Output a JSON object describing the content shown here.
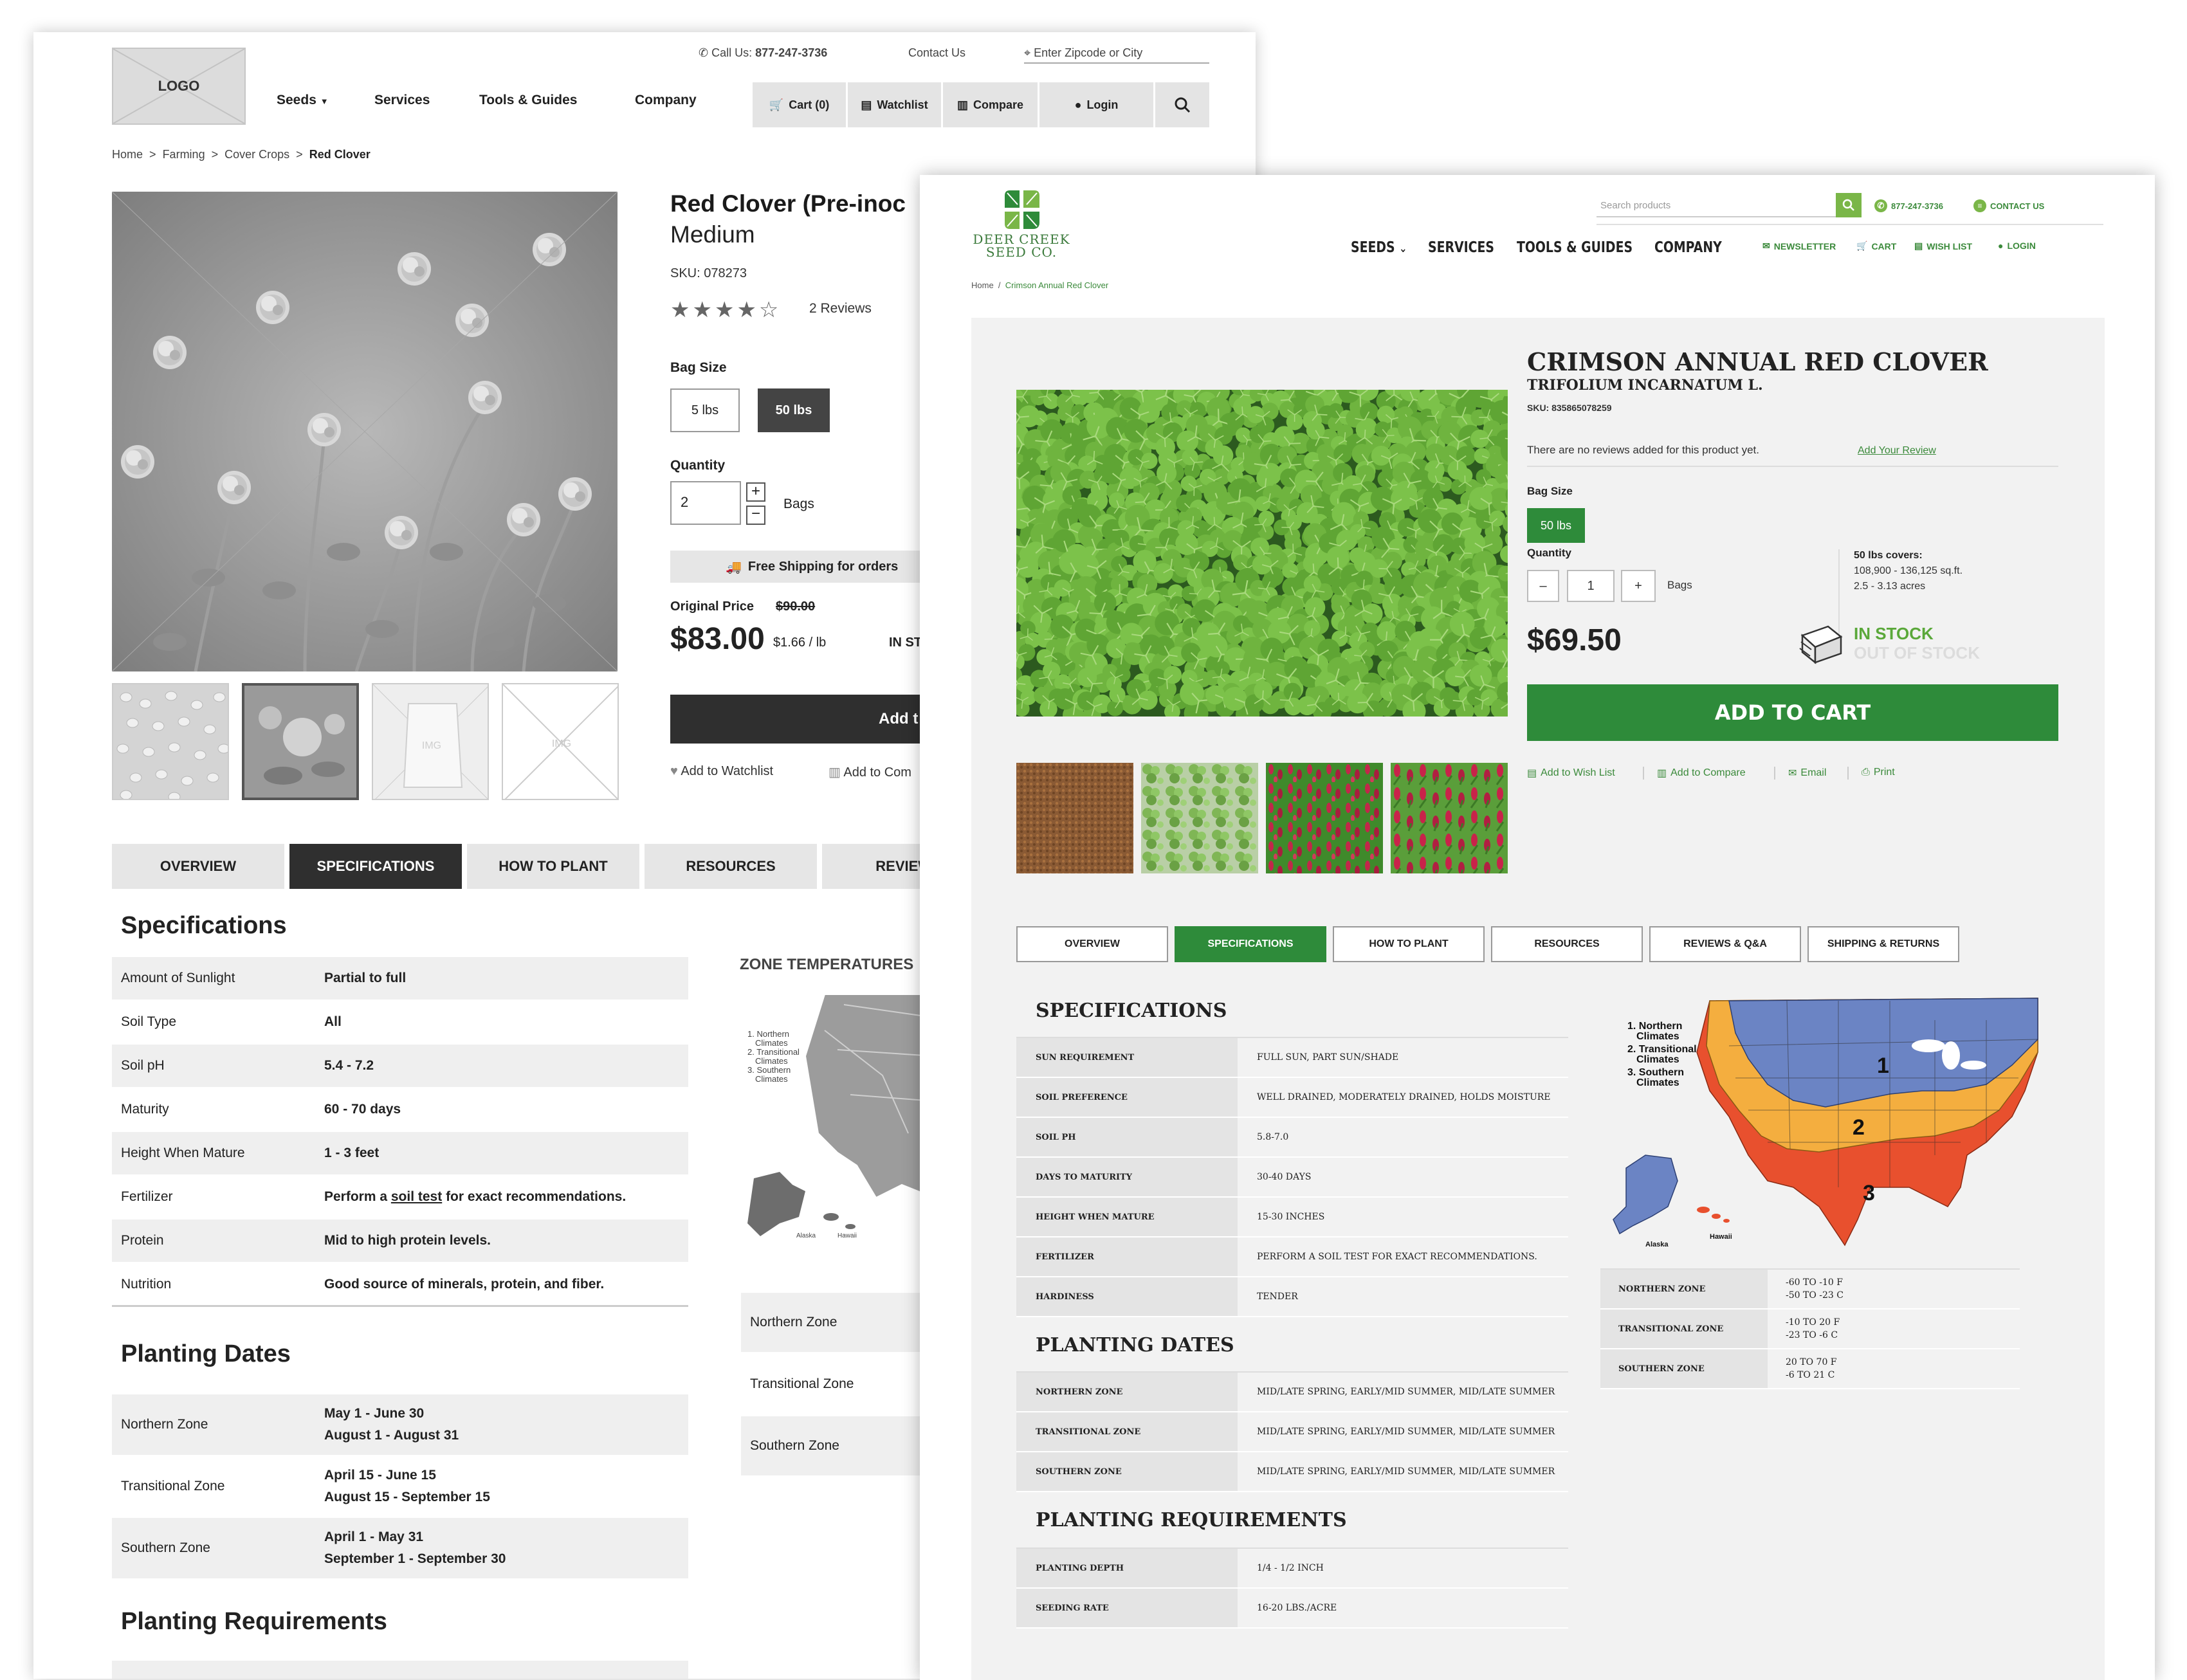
{
  "wireframe": {
    "logo": "LOGO",
    "top_bar": {
      "call_prefix": "Call Us:",
      "phone": "877-247-3736",
      "contact": "Contact Us",
      "zip_placeholder": "Enter Zipcode or City"
    },
    "nav": [
      "Seeds",
      "Services",
      "Tools & Guides",
      "Company"
    ],
    "toolbar": {
      "cart": "Cart (0)",
      "watchlist": "Watchlist",
      "compare": "Compare",
      "login": "Login"
    },
    "breadcrumb": [
      "Home",
      ">",
      "Farming",
      ">",
      "Cover Crops",
      ">",
      "Red Clover"
    ],
    "product": {
      "title": "Red Clover  (Pre-inoc",
      "subtitle": "Medium",
      "sku": "SKU: 078273",
      "stars": "★★★★☆",
      "reviews": "2 Reviews",
      "bag_size_label": "Bag Size",
      "bag_sizes": [
        "5 lbs",
        "50 lbs"
      ],
      "quantity_label": "Quantity",
      "quantity": "2",
      "unit": "Bags",
      "shipping": "Free Shipping for orders",
      "original_price_label": "Original Price",
      "original_price": "$90.00",
      "price": "$83.00",
      "per_lb": "$1.66 / lb",
      "stock": "IN ST",
      "add_button": "Add t",
      "watchlist": "Add to Watchlist",
      "compare": "Add to Com"
    },
    "thumb_img_label": "IMG",
    "tabs": [
      "OVERVIEW",
      "SPECIFICATIONS",
      "HOW TO PLANT",
      "RESOURCES",
      "REVIEWS"
    ],
    "specs_title": "Specifications",
    "specs": [
      {
        "k": "Amount of Sunlight",
        "v": "Partial to full"
      },
      {
        "k": "Soil Type",
        "v": "All"
      },
      {
        "k": "Soil pH",
        "v": "5.4 - 7.2"
      },
      {
        "k": "Maturity",
        "v": " 60 - 70 days"
      },
      {
        "k": "Height When Mature",
        "v": "1 - 3 feet"
      },
      {
        "k": "Protein",
        "v": "Mid to high protein levels."
      },
      {
        "k": "Nutrition",
        "v": "Good source of minerals, protein, and fiber."
      }
    ],
    "fertilizer": {
      "k": "Fertilizer",
      "pre": "Perform a ",
      "link": "soil test",
      "post": " for exact recommendations."
    },
    "planting_title": "Planting Dates",
    "planting": [
      {
        "k": "Northern Zone",
        "v1": "May 1 - June 30",
        "v2": "August 1 - August 31"
      },
      {
        "k": "Transitional Zone",
        "v1": "April 15 - June 15",
        "v2": "August 15 - September 15"
      },
      {
        "k": "Southern Zone",
        "v1": "April 1 - May 31",
        "v2": "September 1 - September 30"
      }
    ],
    "requirements_title": "Planting Requirements",
    "zone_title": "ZONE TEMPERATURES",
    "zone_legend": [
      "1. Northern",
      "Climates",
      "2. Transitional",
      "Climates",
      "3. Southern",
      "Climates"
    ],
    "zone_map_labels": [
      "Alaska",
      "Hawaii"
    ],
    "zone_rows": [
      "Northern Zone",
      "Transitional Zone",
      "Southern Zone"
    ]
  },
  "real": {
    "brand": {
      "line1": "DEER CREEK",
      "line2": "SEED CO."
    },
    "search_placeholder": "Search products",
    "phone": "877-247-3736",
    "contact": "CONTACT US",
    "nav": [
      "SEEDS",
      "SERVICES",
      "TOOLS & GUIDES",
      "COMPANY"
    ],
    "utility": [
      "NEWSLETTER",
      "CART",
      "WISH LIST",
      "LOGIN"
    ],
    "breadcrumb": {
      "home": "Home",
      "sep": "/",
      "current": "Crimson Annual Red Clover"
    },
    "product": {
      "title": "CRIMSON ANNUAL RED CLOVER",
      "latin": "TRIFOLIUM INCARNATUM L.",
      "sku": "SKU: 835865078259",
      "no_reviews": "There are no reviews added for this product yet.",
      "add_review": "Add Your Review",
      "bag_size_label": "Bag Size",
      "bag_size": "50 lbs",
      "quantity_label": "Quantity",
      "quantity": "1",
      "minus": "–",
      "plus": "+",
      "unit": "Bags",
      "covers_label": "50 lbs covers:",
      "covers_sqft": "108,900 - 136,125 sq.ft.",
      "covers_acres": "2.5 - 3.13 acres",
      "price": "$69.50",
      "in_stock": "IN STOCK",
      "out_of_stock": "OUT OF STOCK",
      "add_to_cart": "ADD TO CART",
      "actions": [
        "Add to Wish List",
        "Add to Compare",
        "Email",
        "Print"
      ]
    },
    "tabs": [
      "OVERVIEW",
      "SPECIFICATIONS",
      "HOW TO PLANT",
      "RESOURCES",
      "REVIEWS & Q&A",
      "SHIPPING & RETURNS"
    ],
    "specs_title": "SPECIFICATIONS",
    "specs": [
      {
        "k": "SUN REQUIREMENT",
        "v": "FULL SUN, PART SUN/SHADE"
      },
      {
        "k": "SOIL PREFERENCE",
        "v": "WELL DRAINED, MODERATELY DRAINED, HOLDS MOISTURE"
      },
      {
        "k": "SOIL PH",
        "v": "5.8-7.0"
      },
      {
        "k": "DAYS TO MATURITY",
        "v": "30-40 DAYS"
      },
      {
        "k": "HEIGHT WHEN MATURE",
        "v": "15-30 INCHES"
      },
      {
        "k": "FERTILIZER",
        "v": "PERFORM A SOIL TEST FOR EXACT RECOMMENDATIONS."
      },
      {
        "k": "HARDINESS",
        "v": "TENDER"
      }
    ],
    "planting_title": "PLANTING DATES",
    "planting": [
      {
        "k": "NORTHERN ZONE",
        "v": "MID/LATE SPRING, EARLY/MID SUMMER, MID/LATE SUMMER"
      },
      {
        "k": "TRANSITIONAL ZONE",
        "v": "MID/LATE SPRING, EARLY/MID SUMMER, MID/LATE SUMMER"
      },
      {
        "k": "SOUTHERN ZONE",
        "v": "MID/LATE SPRING, EARLY/MID SUMMER, MID/LATE SUMMER"
      }
    ],
    "requirements_title": "PLANTING REQUIREMENTS",
    "requirements": [
      {
        "k": "PLANTING DEPTH",
        "v": "1/4 - 1/2 INCH"
      },
      {
        "k": "SEEDING RATE",
        "v": "16-20 LBS./ACRE"
      }
    ],
    "zone_legend": [
      "1. Northern",
      "Climates",
      "2. Transitional",
      "Climates",
      "3. Southern",
      "Climates"
    ],
    "zone_numbers": [
      "1",
      "2",
      "3"
    ],
    "zone_map_labels": [
      "Alaska",
      "Hawaii"
    ],
    "zone_temps": [
      {
        "k": "NORTHERN ZONE",
        "v1": "-60 TO -10 F",
        "v2": "-50 TO -23 C"
      },
      {
        "k": "TRANSITIONAL ZONE",
        "v1": "-10 TO 20 F",
        "v2": "-23 TO -6 C"
      },
      {
        "k": "SOUTHERN ZONE",
        "v1": "20 TO 70 F",
        "v2": "-6 TO 21 C"
      }
    ],
    "colors": {
      "brand_green": "#2e8b3a",
      "light_green": "#7ab648",
      "zone1": "#6b84c4",
      "zone2": "#f4ae3f",
      "zone3": "#e8502e"
    }
  }
}
